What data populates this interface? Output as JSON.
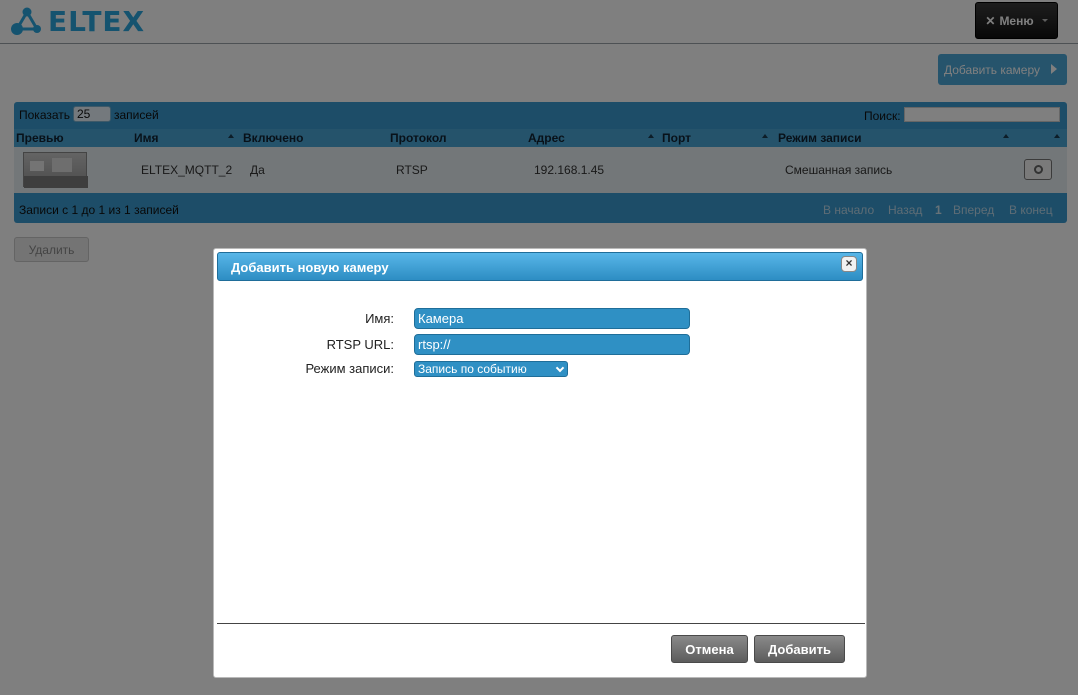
{
  "header": {
    "logo_text": "ELTEX",
    "menu_label": "Меню"
  },
  "toolbar": {
    "add_camera_label": "Добавить камеру"
  },
  "table": {
    "show_label": "Показать",
    "page_size": "25",
    "entries_label": "записей",
    "search_label": "Поиск:",
    "columns": [
      "Превью",
      "Имя",
      "Включено",
      "Протокол",
      "Адрес",
      "Порт",
      "Режим записи"
    ],
    "rows": [
      {
        "name": "ELTEX_MQTT_2",
        "enabled": "Да",
        "protocol": "RTSP",
        "address": "192.168.1.45",
        "port": "",
        "record_mode": "Смешанная запись"
      }
    ],
    "info": "Записи с 1 до 1 из 1 записей",
    "pagination": {
      "first": "В начало",
      "prev": "Назад",
      "current": "1",
      "next": "Вперед",
      "last": "В конец"
    }
  },
  "delete_label": "Удалить",
  "dialog": {
    "title": "Добавить новую камеру",
    "close_label": "×",
    "name_label": "Имя:",
    "name_value": "Камера",
    "rtsp_label": "RTSP URL:",
    "rtsp_value": "rtsp://",
    "mode_label": "Режим записи:",
    "mode_value": "Запись по событию",
    "cancel_label": "Отмена",
    "add_label": "Добавить"
  },
  "colors": {
    "accent": "#2ba7df",
    "table_header": "#3a9bd0",
    "dialog_title": "#2d8dc3"
  }
}
